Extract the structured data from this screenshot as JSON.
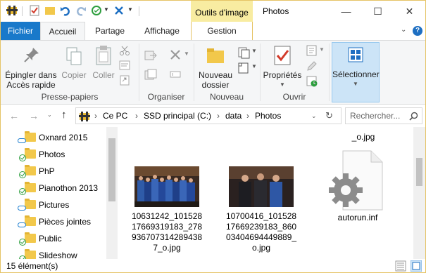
{
  "window": {
    "title": "Photos",
    "context_tab": "Outils d'image",
    "minimize": "—",
    "maximize": "☐",
    "close": "✕"
  },
  "tabs": {
    "file": "Fichier",
    "home": "Accueil",
    "share": "Partage",
    "view": "Affichage",
    "manage": "Gestion"
  },
  "ribbon": {
    "pin": "Épingler dans Accès rapide",
    "pin_line1": "Épingler dans",
    "pin_line2": "Accès rapide",
    "copy": "Copier",
    "paste": "Coller",
    "group_clipboard": "Presse-papiers",
    "group_organize": "Organiser",
    "new_folder_line1": "Nouveau",
    "new_folder_line2": "dossier",
    "group_new": "Nouveau",
    "properties": "Propriétés",
    "group_open": "Ouvrir",
    "select": "Sélectionner"
  },
  "address": {
    "crumbs": [
      "Ce PC",
      "SSD principal (C:)",
      "data",
      "Photos"
    ],
    "search_placeholder": "Rechercher..."
  },
  "tree": {
    "items": [
      {
        "label": "Oxnard 2015",
        "status": "cloud"
      },
      {
        "label": "Photos",
        "status": "ok"
      },
      {
        "label": "PhP",
        "status": "ok"
      },
      {
        "label": "Pianothon 2013",
        "status": "ok"
      },
      {
        "label": "Pictures",
        "status": "cloud"
      },
      {
        "label": "Pièces jointes",
        "status": "cloud"
      },
      {
        "label": "Public",
        "status": "ok"
      },
      {
        "label": "Slideshow",
        "status": "ok"
      }
    ]
  },
  "files": [
    {
      "name": "_o.jpg",
      "type": "partial"
    },
    {
      "name": "10631242_101528 17669319183_278 936707314289438 7_o.jpg",
      "lines": [
        "10631242_101528",
        "17669319183_278",
        "936707314289438",
        "7_o.jpg"
      ],
      "type": "photo"
    },
    {
      "name": "10700416_101528 17669239183_860 03404694449889_ o.jpg",
      "lines": [
        "10700416_101528",
        "17669239183_860",
        "03404694449889_",
        "o.jpg"
      ],
      "type": "photo"
    },
    {
      "name": "autorun.inf",
      "type": "settings"
    }
  ],
  "status": {
    "count": "15 élément(s)"
  },
  "colors": {
    "accent": "#1979ca",
    "context": "#f8eca1",
    "select_bg": "#cce4f7"
  }
}
